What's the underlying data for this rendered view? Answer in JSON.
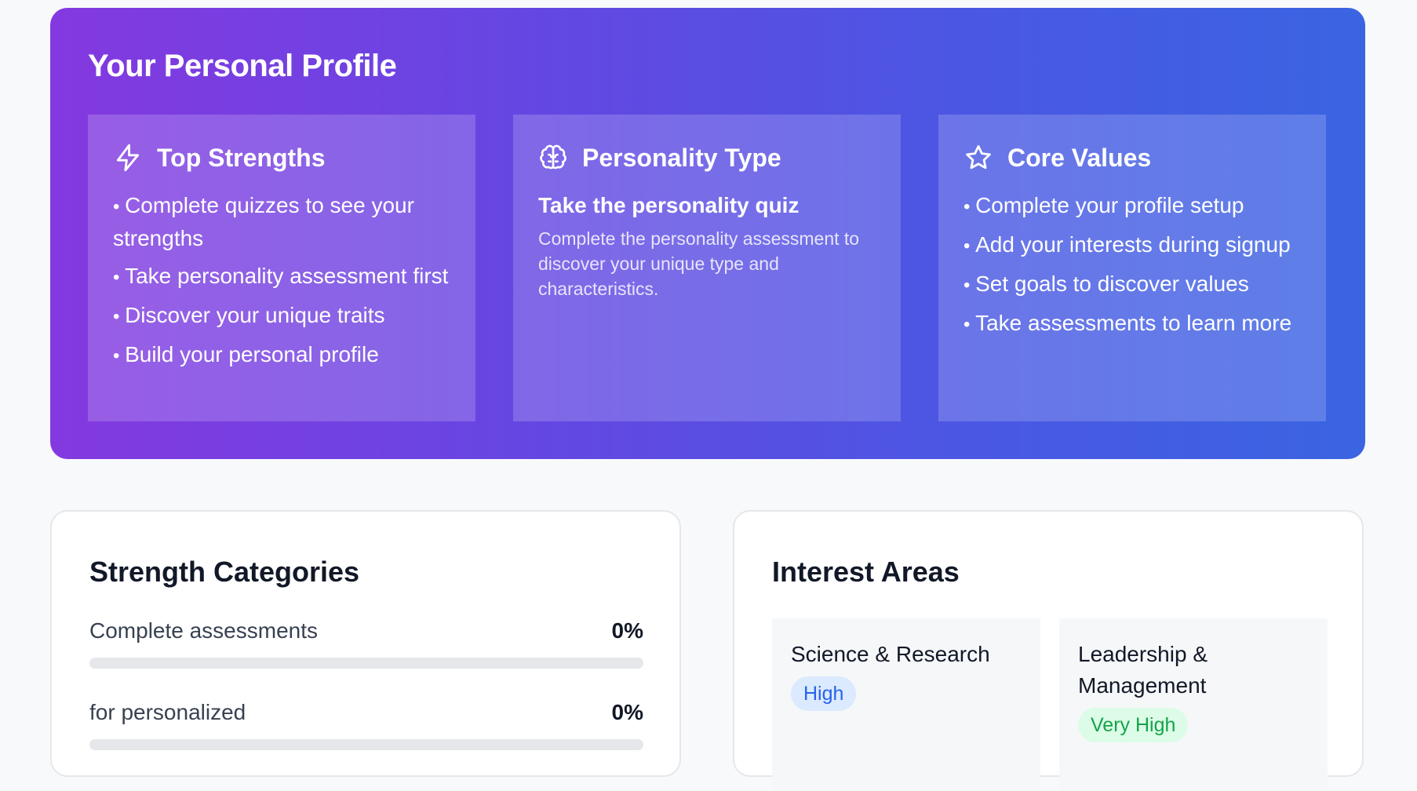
{
  "hero": {
    "title": "Your Personal Profile",
    "strengths": {
      "title": "Top Strengths",
      "icon": "lightning-icon",
      "items": [
        "Complete quizzes to see your strengths",
        "Take personality assessment first",
        "Discover your unique traits",
        "Build your personal profile"
      ]
    },
    "personality": {
      "title": "Personality Type",
      "icon": "brain-icon",
      "subtitle": "Take the personality quiz",
      "description": "Complete the personality assessment to discover your unique type and characteristics."
    },
    "values": {
      "title": "Core Values",
      "icon": "star-icon",
      "items": [
        "Complete your profile setup",
        "Add your interests during signup",
        "Set goals to discover values",
        "Take assessments to learn more"
      ]
    }
  },
  "strength_categories": {
    "title": "Strength Categories",
    "rows": [
      {
        "label": "Complete assessments",
        "percent": "0%",
        "value": 0
      },
      {
        "label": "for personalized",
        "percent": "0%",
        "value": 0
      }
    ]
  },
  "interest_areas": {
    "title": "Interest Areas",
    "items": [
      {
        "name": "Science & Research",
        "level": "High"
      },
      {
        "name": "Leadership & Management",
        "level": "Very High"
      }
    ]
  },
  "colors": {
    "gradient_start": "#8439e0",
    "gradient_end": "#3a64e2",
    "badge_high": "#2563eb",
    "badge_very_high": "#16a34a"
  }
}
